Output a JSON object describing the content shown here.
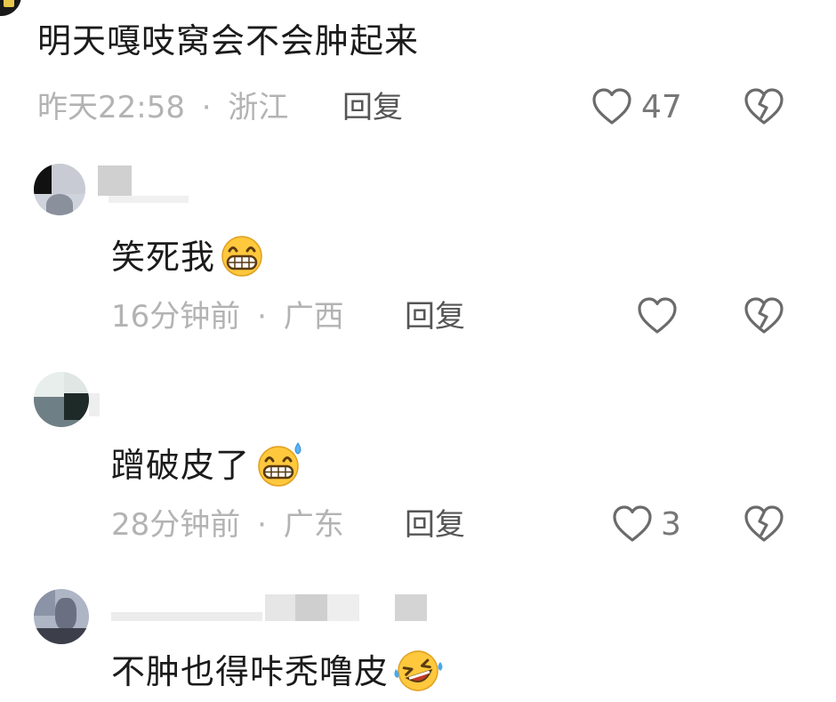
{
  "comments": [
    {
      "text": "明天嘎吱窝会不会肿起来",
      "time": "昨天22:58",
      "location": "浙江",
      "reply_label": "回复",
      "likes": "47",
      "emoji": "none"
    },
    {
      "text": "笑死我",
      "time": "16分钟前",
      "location": "广西",
      "reply_label": "回复",
      "likes": "",
      "emoji": "grin-emoji"
    },
    {
      "text": "蹭破皮了",
      "time": "28分钟前",
      "location": "广东",
      "reply_label": "回复",
      "likes": "3",
      "emoji": "grin-sweat-emoji"
    },
    {
      "text": "不肿也得咔秃噜皮",
      "emoji": "rolling-laugh-emoji"
    }
  ],
  "separator": "·",
  "icons": {
    "like": "heart-outline-icon",
    "dislike": "broken-heart-icon"
  },
  "colors": {
    "text": "#1b1b1b",
    "meta": "#b3b3b3",
    "reply": "#555555",
    "icon": "#6b6b6b",
    "emoji_face": "#ffc83d"
  }
}
